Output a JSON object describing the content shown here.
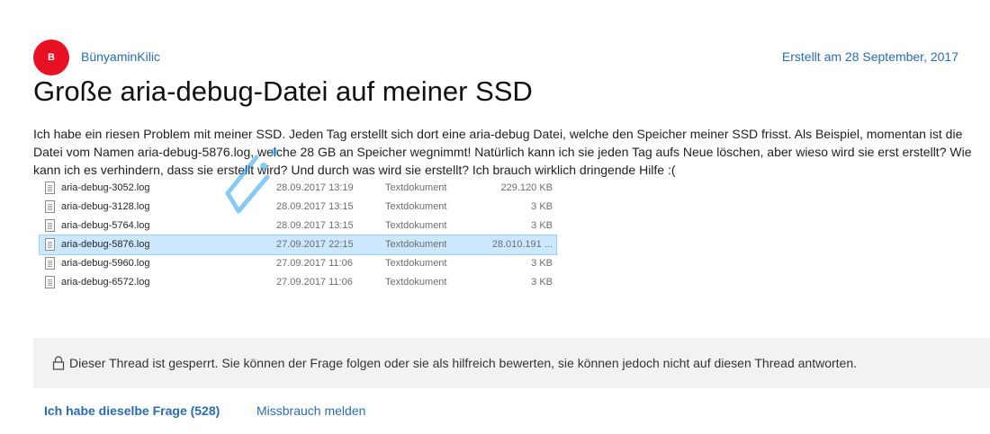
{
  "author": {
    "initial": "B",
    "name": "BünyaminKilic",
    "created": "Erstellt am 28 September, 2017"
  },
  "question": {
    "title": "Große aria-debug-Datei auf meiner SSD",
    "body": "Ich habe ein riesen Problem mit meiner SSD. Jeden Tag erstellt sich dort eine aria-debug Datei, welche den Speicher meiner SSD frisst. Als Beispiel, momentan ist die Datei vom Namen aria-debug-5876.log, welche 28 GB an Speicher wegnimmt! Natürlich kann ich sie jeden Tag aufs Neue löschen, aber wieso wird sie erst erstellt? Wie kann ich es verhindern, dass sie erstellt wird? Und durch was wird sie erstellt? Ich brauch wirklich dringende Hilfe :("
  },
  "files": [
    {
      "name": "aria-debug-3052.log",
      "date": "28.09.2017 13:19",
      "type": "Textdokument",
      "size": "229.120 KB",
      "selected": false
    },
    {
      "name": "aria-debug-3128.log",
      "date": "28.09.2017 13:15",
      "type": "Textdokument",
      "size": "3 KB",
      "selected": false
    },
    {
      "name": "aria-debug-5764.log",
      "date": "28.09.2017 13:15",
      "type": "Textdokument",
      "size": "3 KB",
      "selected": false
    },
    {
      "name": "aria-debug-5876.log",
      "date": "27.09.2017 22:15",
      "type": "Textdokument",
      "size": "28.010.191 ...",
      "selected": true
    },
    {
      "name": "aria-debug-5960.log",
      "date": "27.09.2017 11:06",
      "type": "Textdokument",
      "size": "3 KB",
      "selected": false
    },
    {
      "name": "aria-debug-6572.log",
      "date": "27.09.2017 11:06",
      "type": "Textdokument",
      "size": "3 KB",
      "selected": false
    }
  ],
  "locked": {
    "icon": "lock-icon",
    "text": "Dieser Thread ist gesperrt. Sie können der Frage folgen oder sie als hilfreich bewerten, sie können jedoch nicht auf diesen Thread antworten."
  },
  "actions": {
    "same_question": "Ich habe dieselbe Frage (528)",
    "report_abuse": "Missbrauch melden"
  },
  "colors": {
    "accent": "#2b6cb0",
    "avatar": "#e81123",
    "selection": "#cce8ff"
  }
}
